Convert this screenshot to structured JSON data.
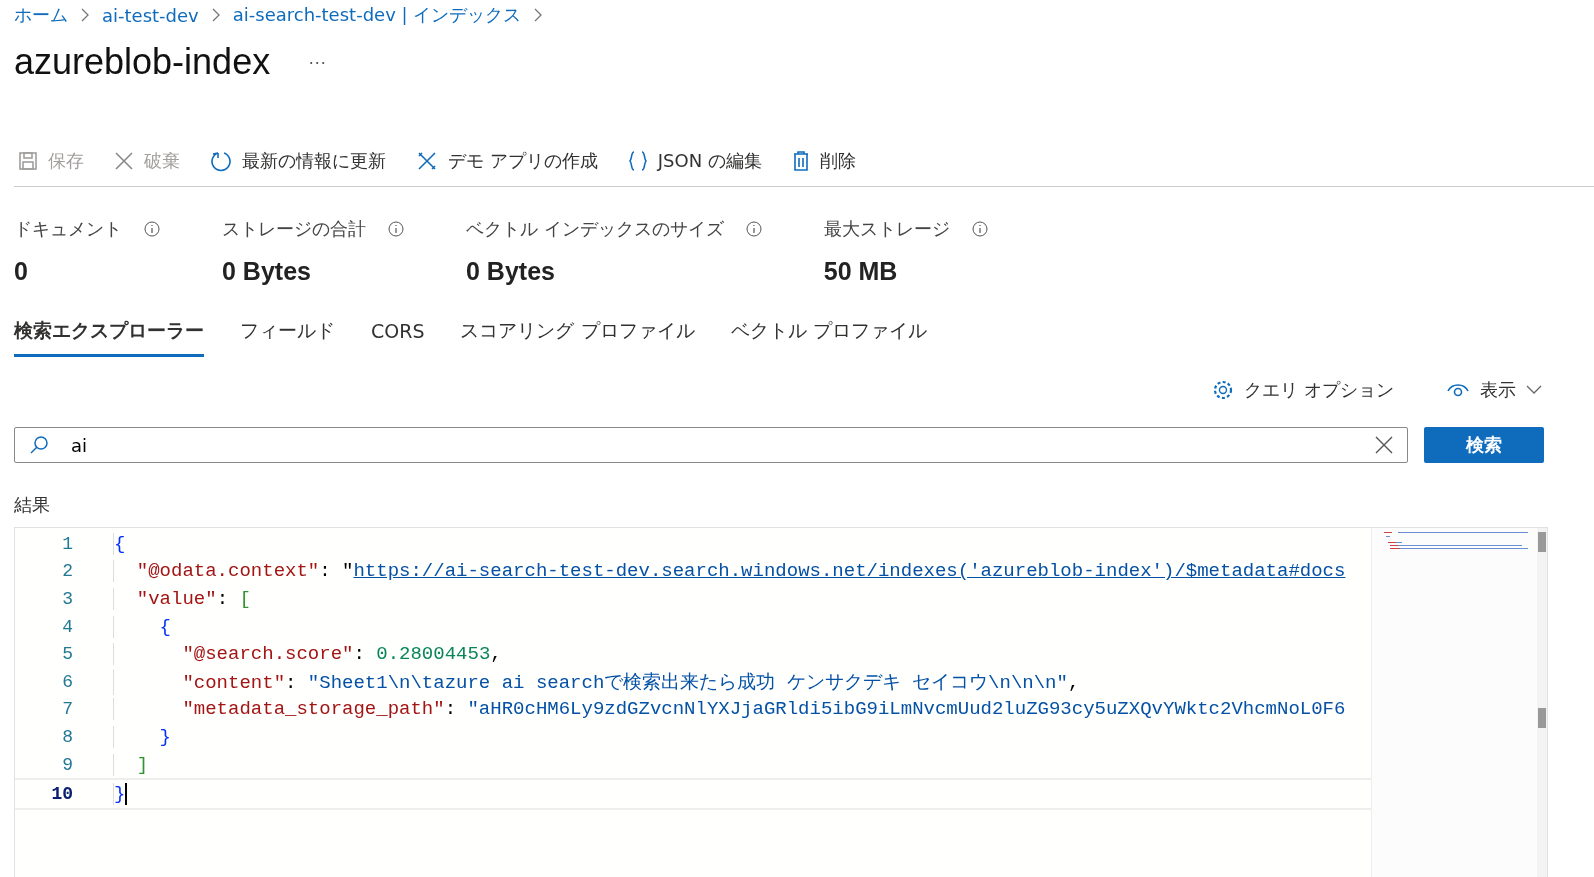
{
  "breadcrumb": [
    "ホーム",
    "ai-test-dev",
    "ai-search-test-dev | インデックス"
  ],
  "title": "azureblob-index",
  "more": "···",
  "toolbar": [
    {
      "kind": "save",
      "label": "保存",
      "disabled": true
    },
    {
      "kind": "discard",
      "label": "破棄",
      "disabled": true
    },
    {
      "kind": "refresh",
      "label": "最新の情報に更新",
      "disabled": false
    },
    {
      "kind": "demo",
      "label": "デモ アプリの作成",
      "disabled": false
    },
    {
      "kind": "json",
      "label": "JSON の編集",
      "disabled": false
    },
    {
      "kind": "delete",
      "label": "削除",
      "disabled": false
    }
  ],
  "stats": [
    {
      "label": "ドキュメント",
      "value": "0"
    },
    {
      "label": "ストレージの合計",
      "value": "0 Bytes"
    },
    {
      "label": "ベクトル インデックスのサイズ",
      "value": "0 Bytes"
    },
    {
      "label": "最大ストレージ",
      "value": "50 MB"
    }
  ],
  "tabs": [
    {
      "label": "検索エクスプローラー",
      "selected": true
    },
    {
      "label": "フィールド",
      "selected": false
    },
    {
      "label": "CORS",
      "selected": false
    },
    {
      "label": "スコアリング プロファイル",
      "selected": false
    },
    {
      "label": "ベクトル プロファイル",
      "selected": false
    }
  ],
  "query_options": "クエリ オプション",
  "view": "表示",
  "search": {
    "value": "ai",
    "button": "検索"
  },
  "results_label": "結果",
  "code_lines": [
    {
      "number": "1",
      "current": false,
      "tokens": [
        {
          "kind": "punct",
          "text": "{"
        }
      ]
    },
    {
      "number": "2",
      "current": false,
      "tokens": [
        {
          "kind": "key",
          "text": "  \"@odata.context\""
        },
        {
          "kind": "plain",
          "text": ": \""
        },
        {
          "kind": "link",
          "text": "https://ai-search-test-dev.search.windows.net/indexes('azureblob-index')/$metadata#docs"
        }
      ]
    },
    {
      "number": "3",
      "current": false,
      "tokens": [
        {
          "kind": "key",
          "text": "  \"value\""
        },
        {
          "kind": "plain",
          "text": ": "
        },
        {
          "kind": "bracket",
          "text": "["
        }
      ]
    },
    {
      "number": "4",
      "current": false,
      "tokens": [
        {
          "kind": "punct",
          "text": "    {"
        }
      ]
    },
    {
      "number": "5",
      "current": false,
      "tokens": [
        {
          "kind": "key",
          "text": "      \"@search.score\""
        },
        {
          "kind": "plain",
          "text": ": "
        },
        {
          "kind": "number",
          "text": "0.28004453"
        },
        {
          "kind": "plain",
          "text": ","
        }
      ]
    },
    {
      "number": "6",
      "current": false,
      "tokens": [
        {
          "kind": "key",
          "text": "      \"content\""
        },
        {
          "kind": "plain",
          "text": ": "
        },
        {
          "kind": "string",
          "text": "\"Sheet1\\n\\tazure ai searchで検索出来たら成功 ケンサクデキ セイコウ\\n\\n\\n\""
        },
        {
          "kind": "plain",
          "text": ","
        }
      ]
    },
    {
      "number": "7",
      "current": false,
      "tokens": [
        {
          "kind": "key",
          "text": "      \"metadata_storage_path\""
        },
        {
          "kind": "plain",
          "text": ": "
        },
        {
          "kind": "string",
          "text": "\"aHR0cHM6Ly9zdGZvcnNlYXJjaGRldi5ibG9iLmNvcmUud2luZG93cy5uZXQvYWktc2VhcmNoL0F6"
        }
      ]
    },
    {
      "number": "8",
      "current": false,
      "tokens": [
        {
          "kind": "punct",
          "text": "    }"
        }
      ]
    },
    {
      "number": "9",
      "current": false,
      "tokens": [
        {
          "kind": "bracket",
          "text": "  ]"
        }
      ]
    },
    {
      "number": "10",
      "current": true,
      "tokens": [
        {
          "kind": "punct",
          "text": "}"
        }
      ]
    }
  ]
}
